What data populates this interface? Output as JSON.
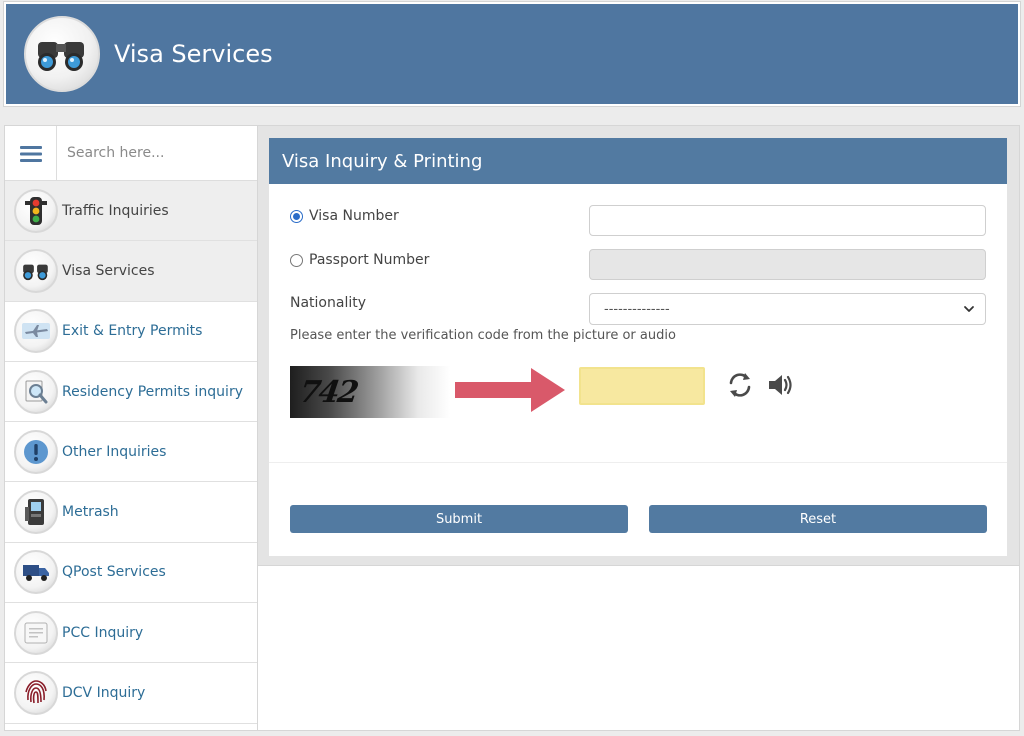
{
  "header": {
    "title": "Visa Services",
    "logo_icon": "binoculars-icon"
  },
  "sidebar": {
    "search_placeholder": "Search here...",
    "menu_icon": "hamburger-menu-icon",
    "items": [
      {
        "label": "Traffic Inquiries",
        "icon": "traffic-light-icon",
        "highlighted": true
      },
      {
        "label": "Visa Services",
        "icon": "binoculars-icon",
        "highlighted": true
      },
      {
        "label": "Exit & Entry Permits",
        "icon": "airplane-icon",
        "highlighted": false
      },
      {
        "label": "Residency Permits inquiry",
        "icon": "magnifier-document-icon",
        "highlighted": false
      },
      {
        "label": "Other Inquiries",
        "icon": "exclamation-icon",
        "highlighted": false
      },
      {
        "label": "Metrash",
        "icon": "kiosk-icon",
        "highlighted": false
      },
      {
        "label": "QPost Services",
        "icon": "delivery-truck-icon",
        "highlighted": false
      },
      {
        "label": "PCC Inquiry",
        "icon": "certificate-icon",
        "highlighted": false
      },
      {
        "label": "DCV Inquiry",
        "icon": "fingerprint-icon",
        "highlighted": false
      }
    ]
  },
  "form": {
    "title": "Visa Inquiry & Printing",
    "visa_number_label": "Visa Number",
    "visa_number_value": "",
    "visa_number_checked": true,
    "passport_number_label": "Passport Number",
    "passport_number_value": "",
    "passport_number_checked": false,
    "nationality_label": "Nationality",
    "nationality_selected": "--------------",
    "verification_instruction": "Please enter the verification code from the picture or audio",
    "captcha_code": "742",
    "captcha_value": "",
    "submit_label": "Submit",
    "reset_label": "Reset"
  },
  "colors": {
    "brand_blue": "#4f76a0",
    "panel_header": "#527aa1",
    "link_text": "#2d6d96",
    "captcha_highlight": "#f7e8a0",
    "arrow": "#d9596a"
  }
}
